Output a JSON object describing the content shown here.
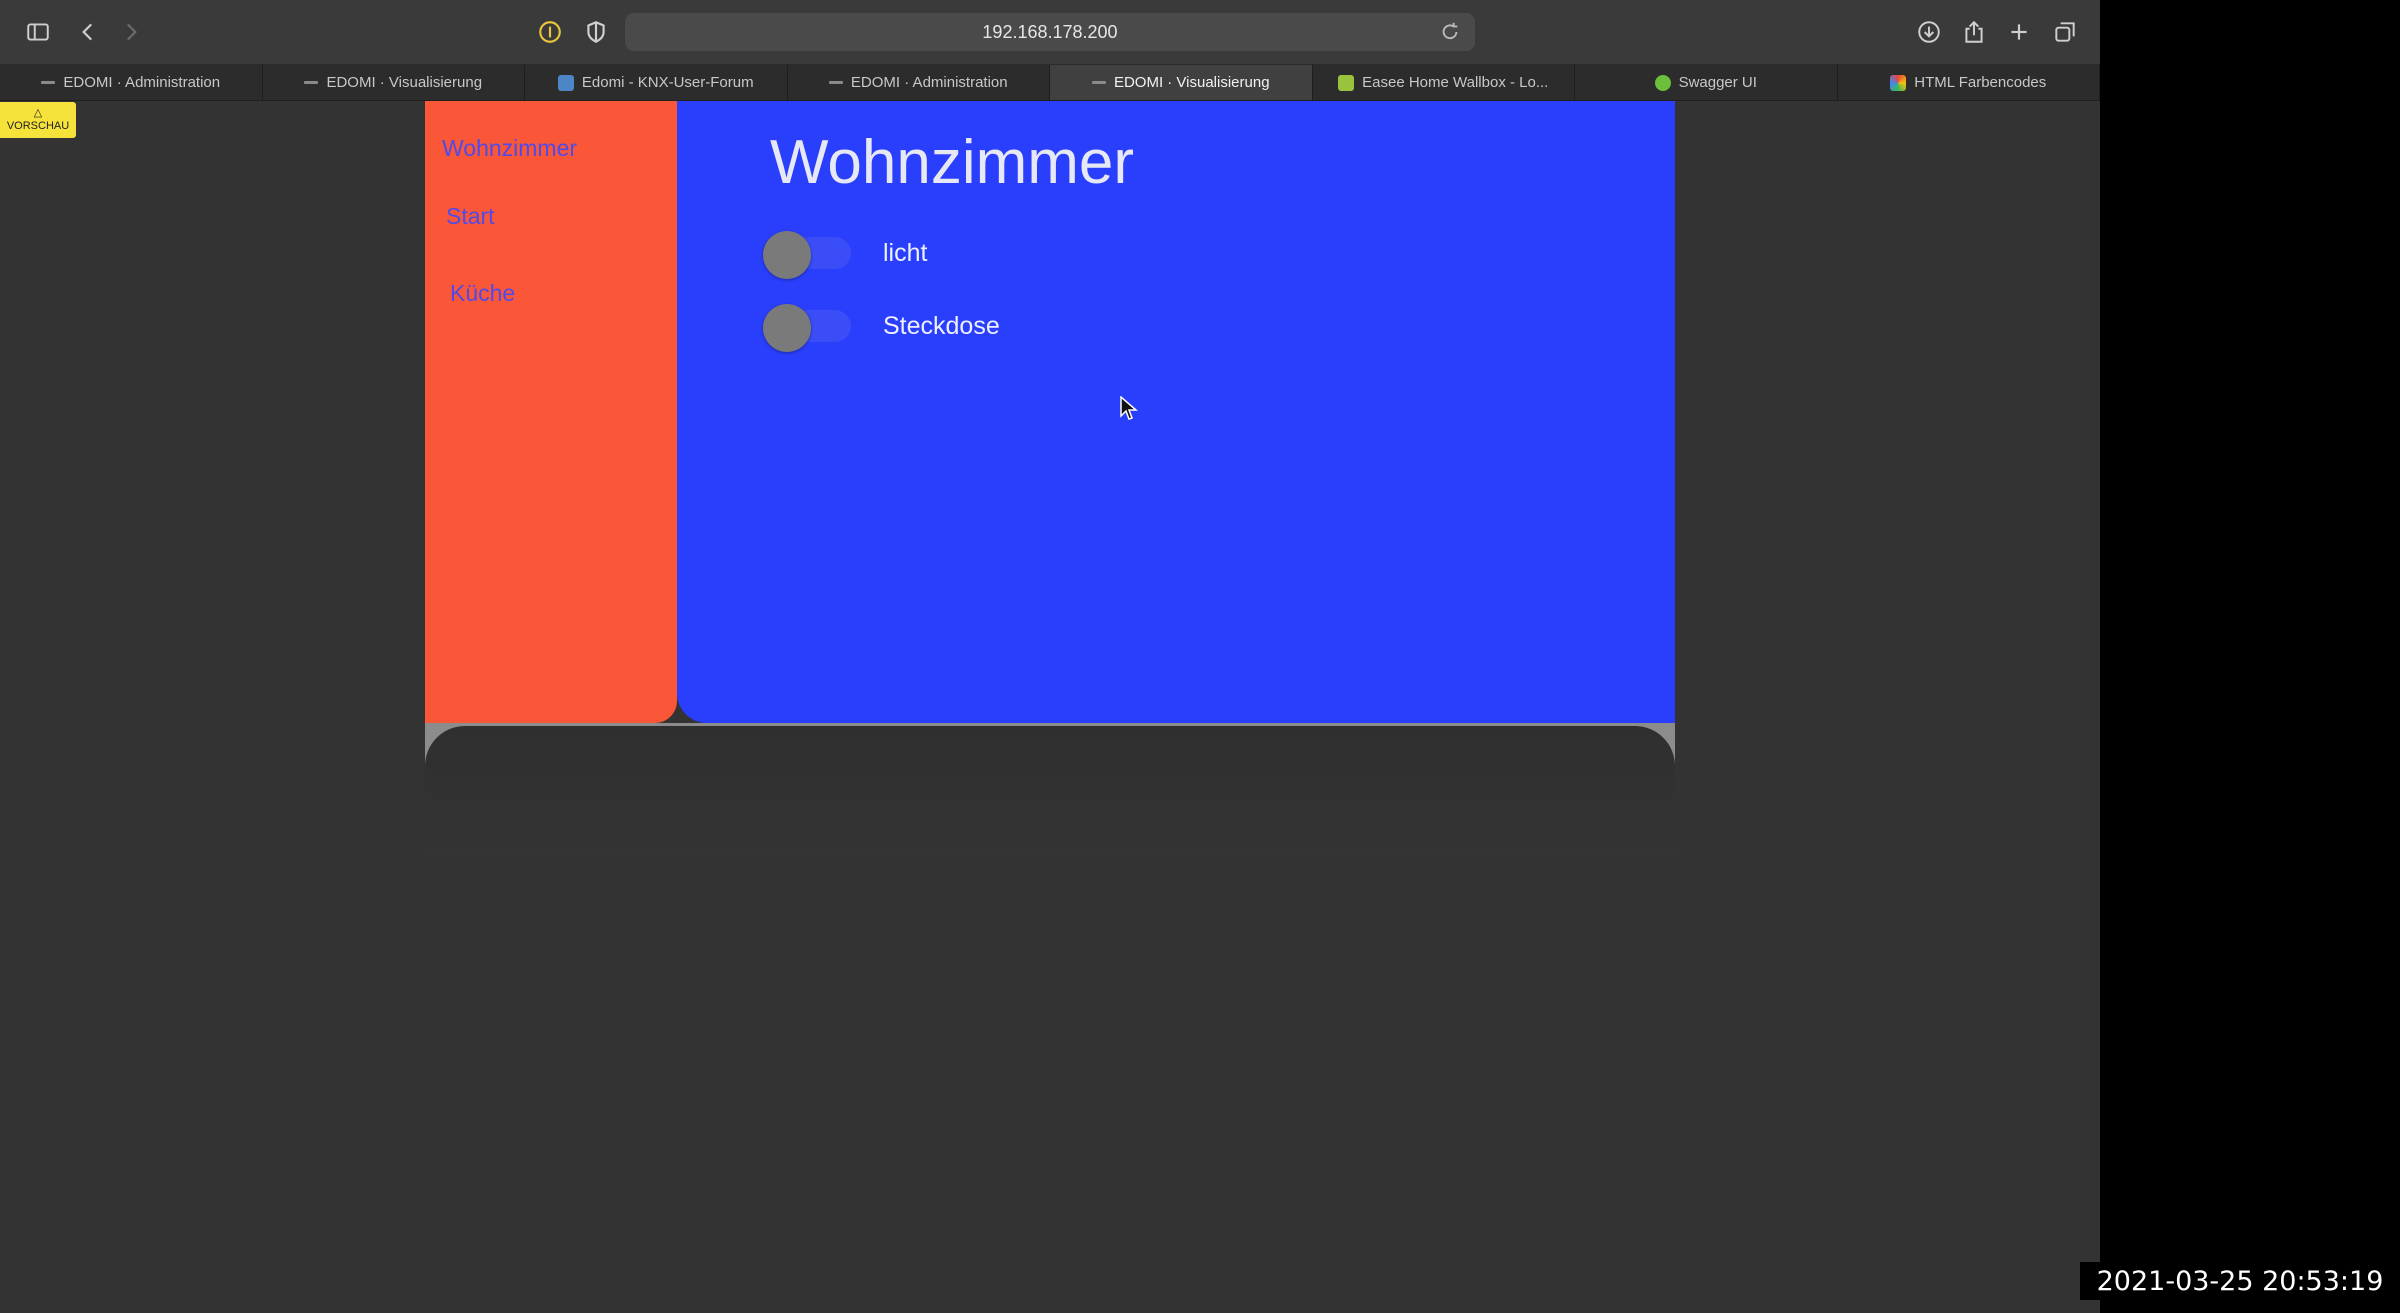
{
  "browser": {
    "address": "192.168.178.200",
    "tabs": [
      {
        "label": "EDOMI · Administration",
        "favicon": "line-icon",
        "active": false
      },
      {
        "label": "EDOMI · Visualisierung",
        "favicon": "line-icon",
        "active": false
      },
      {
        "label": "Edomi - KNX-User-Forum",
        "favicon": "forum-icon",
        "active": false
      },
      {
        "label": "EDOMI · Administration",
        "favicon": "line-icon",
        "active": false
      },
      {
        "label": "EDOMI · Visualisierung",
        "favicon": "line-icon",
        "active": true
      },
      {
        "label": "Easee Home Wallbox - Lo...",
        "favicon": "wallbox-icon",
        "active": false
      },
      {
        "label": "Swagger UI",
        "favicon": "swagger-icon",
        "active": false
      },
      {
        "label": "HTML Farbencodes",
        "favicon": "color-icon",
        "active": false
      }
    ]
  },
  "badge": {
    "symbol": "△",
    "label": "VORSCHAU"
  },
  "visu": {
    "nav": [
      {
        "label": "Wohnzimmer"
      },
      {
        "label": "Start"
      },
      {
        "label": "Küche"
      }
    ],
    "title": "Wohnzimmer",
    "switches": [
      {
        "label": "licht",
        "on": false
      },
      {
        "label": "Steckdose",
        "on": false
      }
    ],
    "colors": {
      "sidebar": "#fa5638",
      "main": "#2a3ffc",
      "nav_text": "#4f4bea"
    }
  },
  "timestamp": "2021-03-25  20:53:19"
}
